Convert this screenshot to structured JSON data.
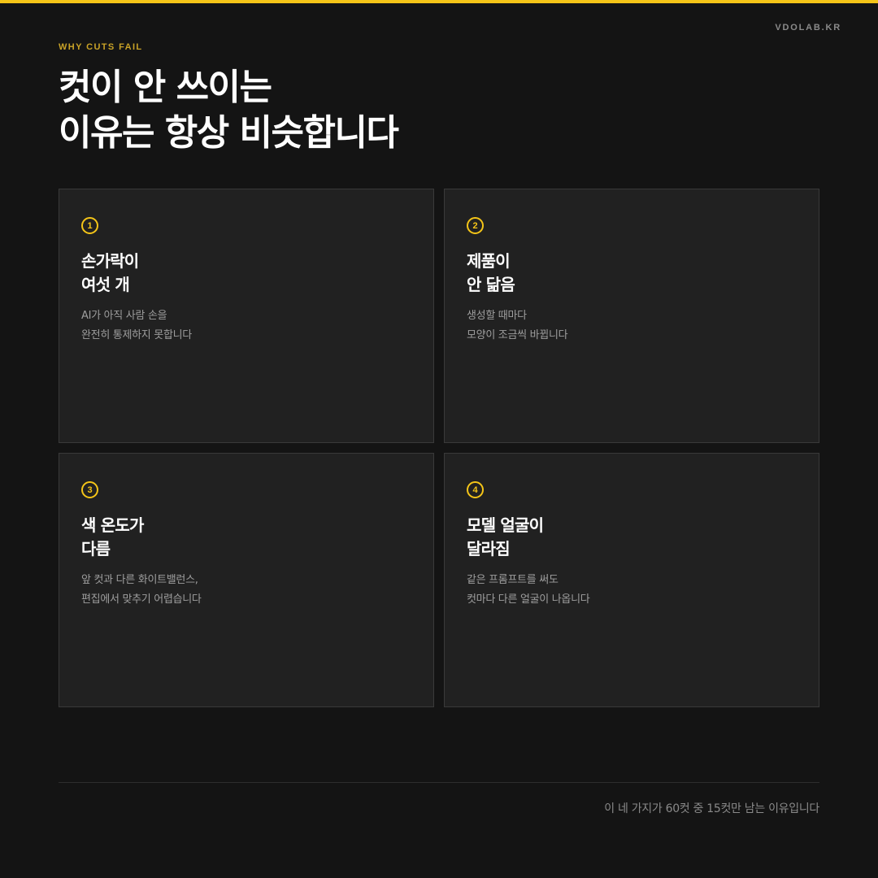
{
  "brand": "VDOLAB.KR",
  "eyebrow": "WHY CUTS FAIL",
  "headline": {
    "line1": "컷이 안 쓰이는",
    "line2": "이유는 항상 비슷합니다"
  },
  "cards": [
    {
      "number": "1",
      "title_line1": "손가락이",
      "title_line2": "여섯 개",
      "desc_line1": "AI가 아직 사람 손을",
      "desc_line2": "완전히 통제하지 못합니다"
    },
    {
      "number": "2",
      "title_line1": "제품이",
      "title_line2": "안 닮음",
      "desc_line1": "생성할 때마다",
      "desc_line2": "모양이 조금씩 바뀝니다"
    },
    {
      "number": "3",
      "title_line1": "색 온도가",
      "title_line2": "다름",
      "desc_line1": "앞 컷과 다른 화이트밸런스,",
      "desc_line2": "편집에서 맞추기 어렵습니다"
    },
    {
      "number": "4",
      "title_line1": "모델 얼굴이",
      "title_line2": "달라짐",
      "desc_line1": "같은 프롬프트를 써도",
      "desc_line2": "컷마다 다른 얼굴이 나옵니다"
    }
  ],
  "footer": "이 네 가지가 60컷 중 15컷만 남는 이유입니다",
  "colors": {
    "accent": "#F5C518",
    "background": "#141414",
    "card": "#212121"
  },
  "icons": [
    "numbered-circle-icon"
  ]
}
